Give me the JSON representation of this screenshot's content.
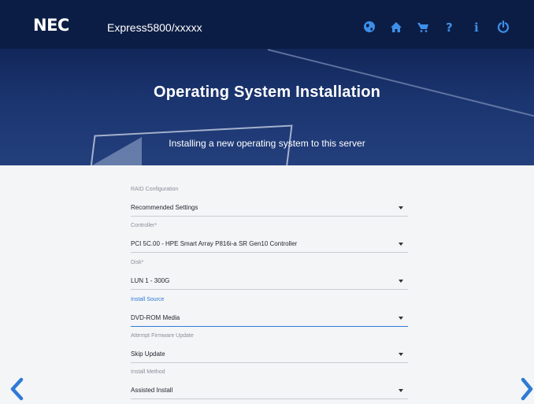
{
  "header": {
    "logo": "NEC",
    "product": "Express5800/xxxxx",
    "icons": [
      "globe-icon",
      "home-icon",
      "cart-icon",
      "help-icon",
      "info-icon",
      "power-icon"
    ]
  },
  "hero": {
    "title": "Operating System Installation",
    "subtitle": "Installing a new operating system to this server"
  },
  "form": {
    "raid": {
      "label": "RAID Configuration",
      "value": "Recommended Settings"
    },
    "controller": {
      "label": "Controller*",
      "value": "PCI 5C.00 - HPE Smart Array P816i-a SR Gen10 Controller"
    },
    "disk": {
      "label": "Disk*",
      "value": "LUN 1 - 300G"
    },
    "source": {
      "label": "Install Source",
      "value": "DVD-ROM Media"
    },
    "firmware": {
      "label": "Attempt Firmware Update",
      "value": "Skip Update"
    },
    "method": {
      "label": "Install Method",
      "value": "Assisted Install"
    }
  },
  "colors": {
    "topbar": "#0c1d45",
    "accent": "#2f7ad6",
    "icon": "#3d8fe8"
  }
}
